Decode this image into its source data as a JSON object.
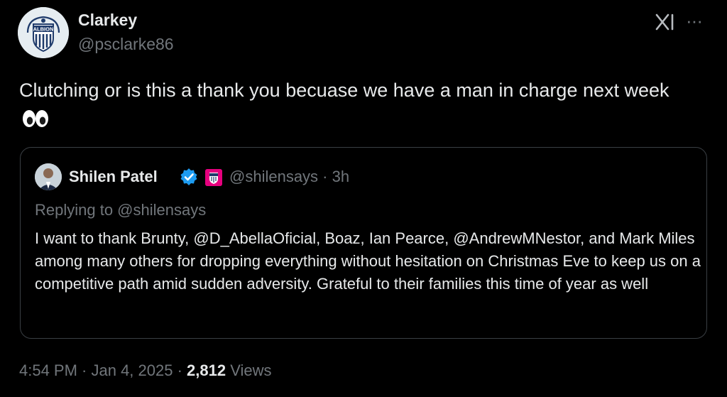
{
  "author": {
    "name": "Clarkey",
    "handle": "@psclarke86",
    "avatar_icon": "albion-crest-icon",
    "avatar_text": "ALBION"
  },
  "header_icons": {
    "logo_icon": "x-grok-logo-icon",
    "more_icon": "more-dots-icon",
    "more_glyph": "···"
  },
  "tweet": {
    "text": "Clutching or is this a thank you becuase we have a man in charge next week",
    "emoji": "eyes-emoji-icon"
  },
  "quote": {
    "name": "Shilen Patel",
    "verified_icon": "verified-badge-icon",
    "affiliate_icon": "club-crest-badge-icon",
    "handle_time": "@shilensays · 3h",
    "replying_to": "Replying to @shilensays",
    "text": "I want to thank Brunty, @D_AbellaOficial, Boaz, Ian Pearce, @AndrewMNestor, and Mark Miles among many others for dropping everything without hesitation on Christmas Eve to keep us on a competitive path amid sudden adversity. Grateful to their families this time of year as well"
  },
  "footer": {
    "time_date": "4:54 PM · Jan 4, 2025 · ",
    "views_count": "2,812",
    "views_label": " Views"
  },
  "colors": {
    "background": "#000000",
    "primary_text": "#e7e9ea",
    "secondary_text": "#71767b",
    "verified_blue": "#1d9bf0",
    "border": "#3a3f44"
  }
}
